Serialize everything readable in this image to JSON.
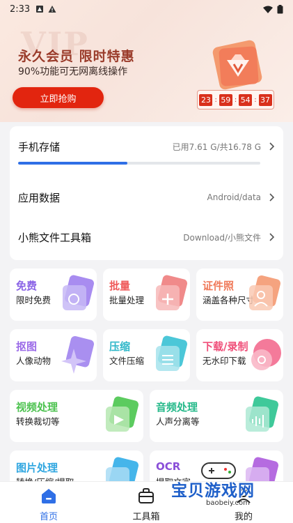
{
  "status_bar": {
    "time": "2:33"
  },
  "banner": {
    "watermark": "VIP",
    "title": "永久会员  限时特惠",
    "subtitle": "90%功能可无网离线操作",
    "button_label": "立即抢购",
    "countdown": [
      "23",
      "59",
      "54",
      "37"
    ]
  },
  "storage_card": {
    "phone_storage": {
      "label": "手机存储",
      "value": "已用7.61 G/共16.78 G",
      "used_fraction": 0.45
    },
    "app_data": {
      "label": "应用数据",
      "value": "Android/data"
    },
    "toolbox": {
      "label": "小熊文件工具箱",
      "value": "Download/小熊文件"
    }
  },
  "tiles": [
    {
      "title": "免费",
      "subtitle": "限时免费",
      "color": "#8a63e6",
      "icon": "free-icon"
    },
    {
      "title": "批量",
      "subtitle": "批量处理",
      "color": "#ef5a5a",
      "icon": "batch-icon"
    },
    {
      "title": "证件照",
      "subtitle": "涵盖各种尺寸",
      "color": "#f07a5a",
      "icon": "id-photo-icon"
    },
    {
      "title": "抠图",
      "subtitle": "人像动物",
      "color": "#9b6be8",
      "icon": "cutout-icon"
    },
    {
      "title": "压缩",
      "subtitle": "文件压缩",
      "color": "#2fb7c9",
      "icon": "compress-icon"
    },
    {
      "title": "下载/录制",
      "subtitle": "无水印下载",
      "color": "#f0507a",
      "icon": "download-icon"
    },
    {
      "title": "视频处理",
      "subtitle": "转换裁切等",
      "color": "#4cc24f",
      "icon": "video-icon"
    },
    {
      "title": "音频处理",
      "subtitle": "人声分离等",
      "color": "#25b98a",
      "icon": "audio-icon"
    },
    {
      "title": "图片处理",
      "subtitle": "转换/压缩/提取",
      "color": "#2fa6e0",
      "icon": "image-icon"
    },
    {
      "title": "OCR",
      "subtitle": "提取文字",
      "color": "#8a4fd8",
      "icon": "ocr-icon"
    }
  ],
  "bottom_nav": {
    "home": "首页",
    "toolbox": "工具箱",
    "mine": "我的",
    "active_color": "#2f6fe6"
  },
  "site_watermark": {
    "text": "宝贝游戏网",
    "url": "baobeiy.com"
  }
}
